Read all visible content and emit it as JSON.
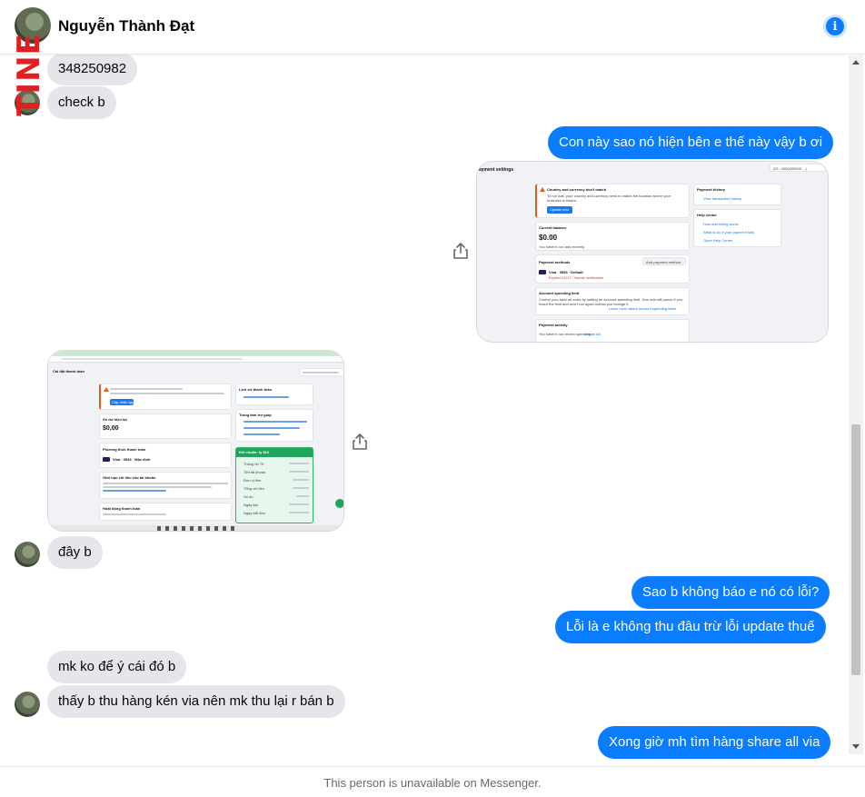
{
  "header": {
    "contact_name": "Nguyễn Thành Đạt",
    "info_icon_glyph": "i",
    "accent_color": "#0a7cff"
  },
  "watermark": {
    "text": "TINE"
  },
  "messages": [
    {
      "from": "them",
      "text": "348250982"
    },
    {
      "from": "them",
      "text": "check b"
    },
    {
      "from": "me",
      "text": "Con này sao nó hiện bên e thế này vậy b ơi"
    },
    {
      "from": "me",
      "type": "image",
      "alt": "payment settings screenshot"
    },
    {
      "from": "them",
      "type": "image",
      "alt": "cài đặt thanh toán screenshot"
    },
    {
      "from": "them",
      "text": "đây b"
    },
    {
      "from": "me",
      "text": "Sao b không báo e nó có lỗi?"
    },
    {
      "from": "me",
      "text": "Lỗi là e không thu đâu trừ lỗi update thuế"
    },
    {
      "from": "them",
      "text": "mk ko để ý cái đó b"
    },
    {
      "from": "them",
      "text": "thấy b thu hàng kén via nên mk thu lại r bán b"
    },
    {
      "from": "me",
      "text": "Xong giờ mh tìm hàng share all via"
    }
  ],
  "screenshot_en": {
    "page_title": "ayment settings",
    "account_id": "(ID:: 0000000000 ...)",
    "warning_title": "Country and currency don't match",
    "warning_body": "To run ads, your country and currency need to match the location where your business is based.",
    "update_button": "Update now",
    "balance_label": "Current balance",
    "balance_value": "$0.00",
    "balance_note": "You haven't run ads recently",
    "methods_label": "Payment methods",
    "add_method": "Add payment method",
    "card_line": "Visa · 3993 · Default",
    "card_note": "Expired 12/17 · Needs verification",
    "limit_label": "Account spending limit",
    "limit_body": "Control your total ad costs by setting an account spending limit. Your ads will pause if you reach the limit and won't run again unless you change it.",
    "limit_link": "Learn more about account spending limits",
    "activity_label": "Payment activity",
    "activity_body": "You haven't run recent spending.",
    "activity_link": "Create Ad",
    "history_label": "Payment history",
    "history_link": "View transaction history",
    "help_label": "Help center",
    "help_1": "How add billing works",
    "help_2": "What to do if your payment fails",
    "help_3": "Open Help Center"
  },
  "screenshot_vi": {
    "page_title": "Cài đặt thanh toán",
    "balance_label": "Số dư hiện tại",
    "balance_value": "$0,00",
    "update_button": "Cập nhật ngay",
    "methods_label": "Phương thức thanh toán",
    "card_line": "Visa · 3993 · Mặc định",
    "limit_label": "Giới hạn chi tiêu cho tài khoản",
    "activity_label": "Hoạt động thanh toán",
    "history_label": "Lịch sử thanh toán",
    "help_label": "Trung tâm trợ giúp",
    "panel_title": "Kết chuẩn: ty $10",
    "panel_rows": [
      "Thông tin TK",
      "Tên tài khoản",
      "Đơn vị tiền",
      "Tổng chi tiêu",
      "Số dư",
      "Ngày tạo",
      "Ngày bắt đầu"
    ]
  },
  "footer": {
    "notice": "This person is unavailable on Messenger."
  }
}
